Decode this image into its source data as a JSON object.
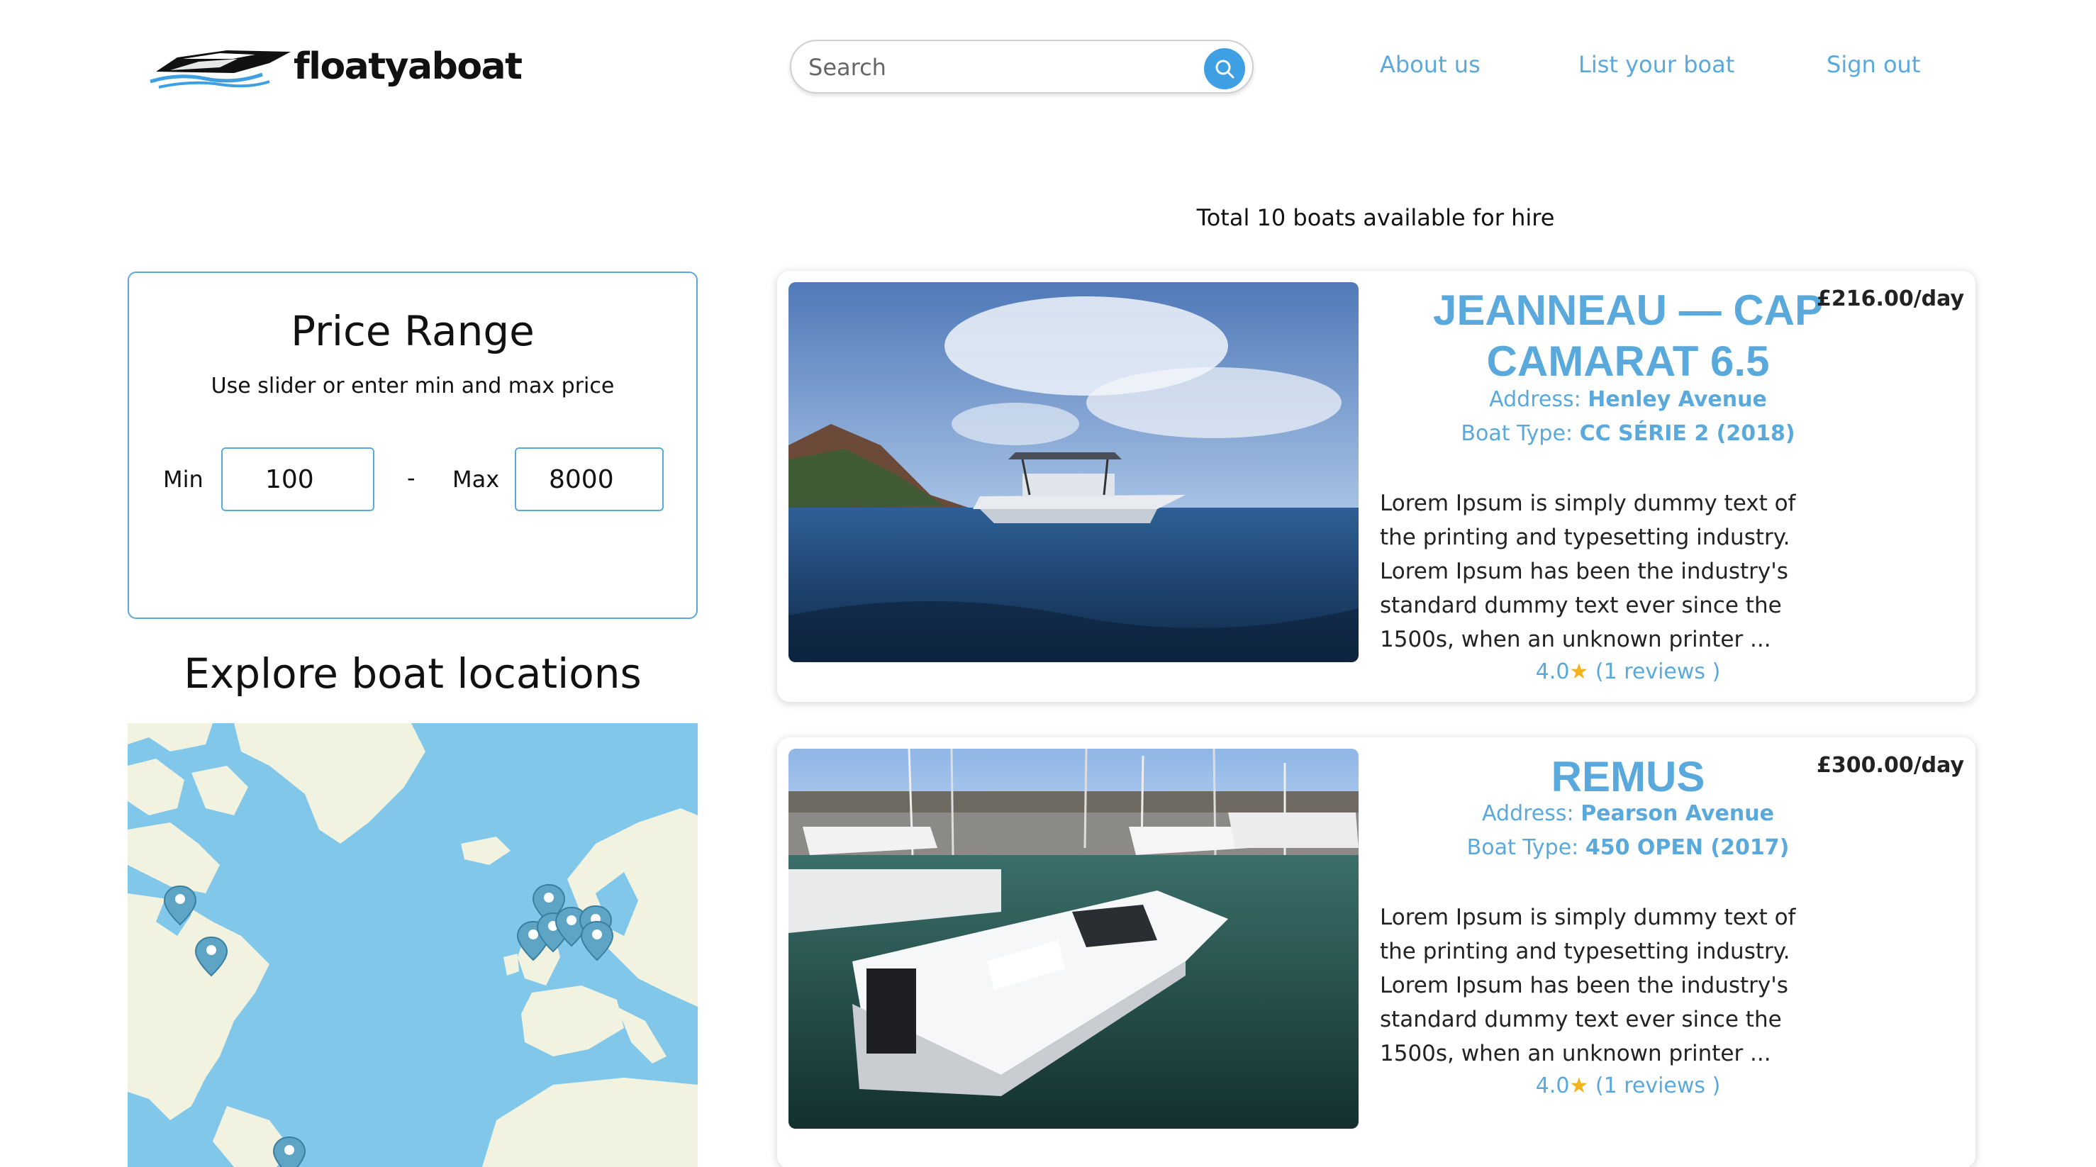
{
  "header": {
    "logo_text": "floatyaboat",
    "search_placeholder": "Search",
    "nav": [
      {
        "label": "About us"
      },
      {
        "label": "List your boat"
      },
      {
        "label": "Sign out"
      }
    ]
  },
  "summary": "Total 10 boats available for hire",
  "price_filter": {
    "title": "Price Range",
    "subtitle": "Use slider or enter min and max price",
    "min_label": "Min",
    "min_value": "100",
    "separator": "-",
    "max_label": "Max",
    "max_value": "8000"
  },
  "map_section": {
    "title": "Explore boat locations"
  },
  "colors": {
    "accent": "#5aa9dc",
    "search_button": "#3ea0e3",
    "water": "#80c7ea",
    "land": "#f1f3e0",
    "marker": "#5ea4c4"
  },
  "boats": [
    {
      "title": "JEANNEAU — CAP CAMARAT 6.5",
      "price": "£216.00/day",
      "address_label": "Address:",
      "address": "Henley Avenue",
      "type_label": "Boat Type:",
      "boat_type": "CC SÉRIE 2 (2018)",
      "description": "Lorem Ipsum is simply dummy text of the printing and typesetting industry. Lorem Ipsum has been the industry's standard dummy text ever since the 1500s, when an unknown printer ...",
      "rating": "4.0",
      "rating_icon": "star-icon",
      "reviews": "(1 reviews )"
    },
    {
      "title": "REMUS",
      "price": "£300.00/day",
      "address_label": "Address:",
      "address": "Pearson Avenue",
      "type_label": "Boat Type:",
      "boat_type": "450 OPEN (2017)",
      "description": "Lorem Ipsum is simply dummy text of the printing and typesetting industry. Lorem Ipsum has been the industry's standard dummy text ever since the 1500s, when an unknown printer ...",
      "rating": "4.0",
      "rating_icon": "star-icon",
      "reviews": "(1 reviews )"
    }
  ]
}
